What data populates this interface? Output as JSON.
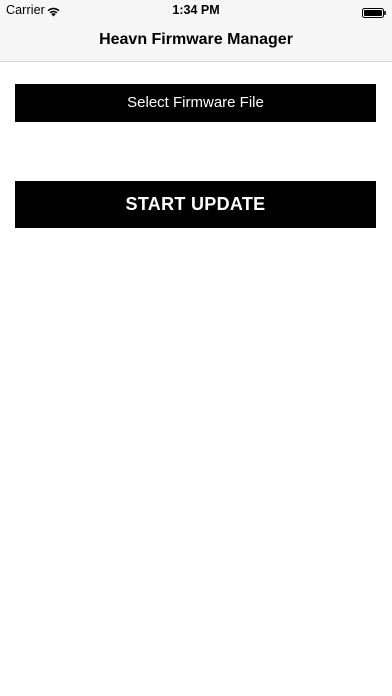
{
  "status_bar": {
    "carrier": "Carrier",
    "time": "1:34 PM",
    "wifi_icon": "wifi-icon",
    "battery_icon": "battery-icon"
  },
  "nav": {
    "title": "Heavn Firmware Manager"
  },
  "main": {
    "select_file_label": "Select Firmware File",
    "start_update_label": "START UPDATE"
  },
  "colors": {
    "button_bg": "#000000",
    "button_text": "#ffffff",
    "bar_bg": "#f7f7f7"
  }
}
